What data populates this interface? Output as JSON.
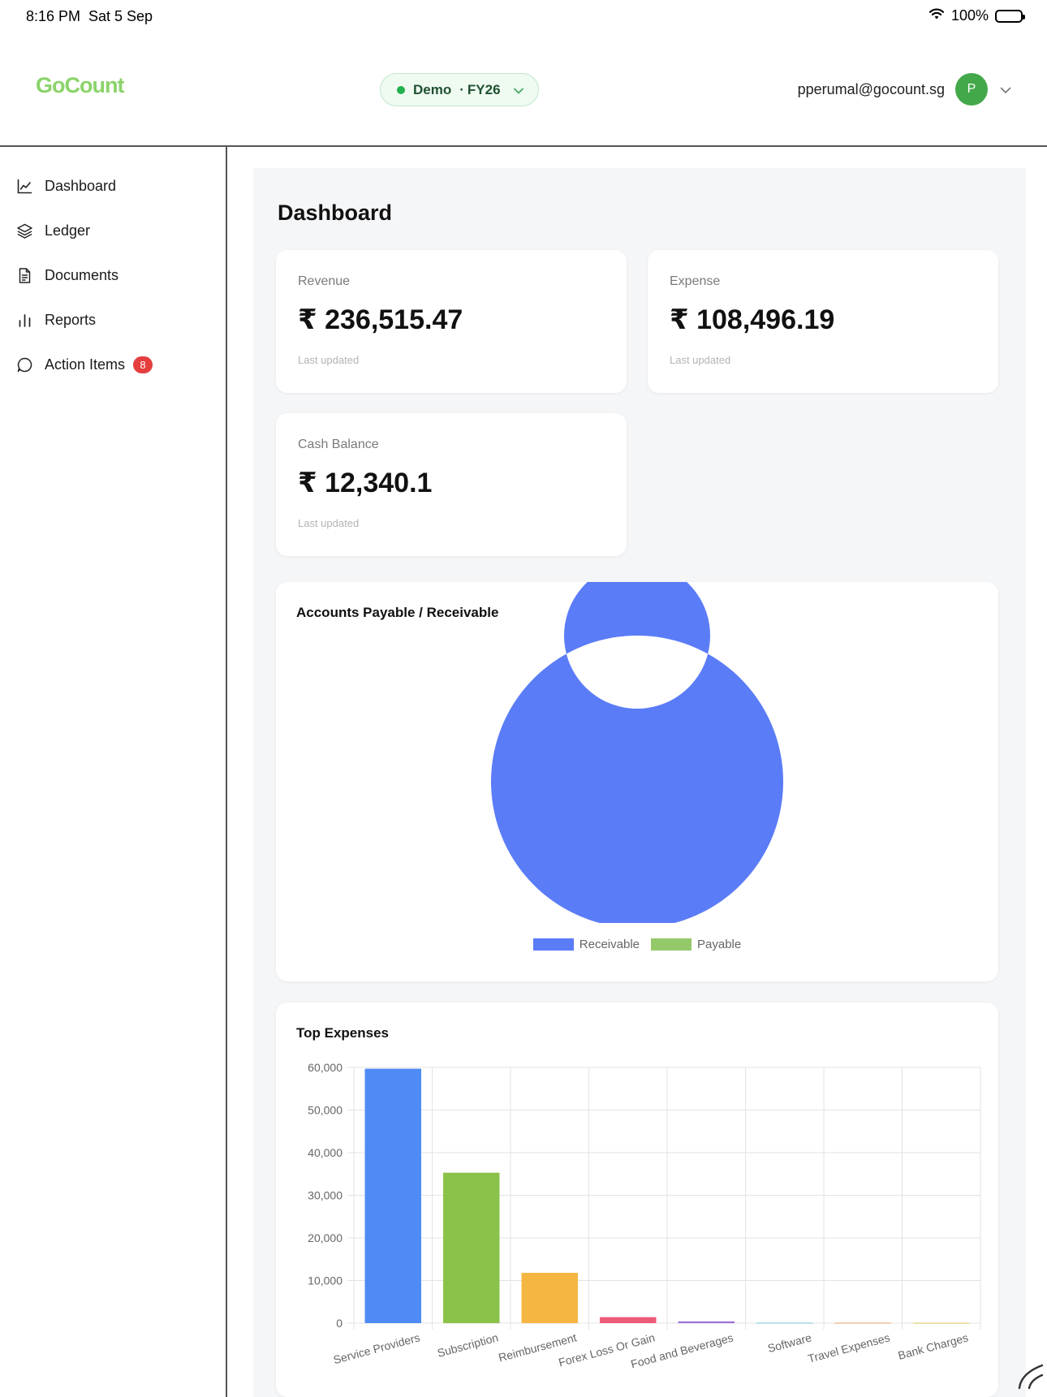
{
  "status_bar": {
    "time": "8:16 PM",
    "date": "Sat 5 Sep",
    "battery": "100%"
  },
  "header": {
    "logo": "GoCount",
    "env_name": "Demo",
    "env_separator": "·",
    "env_fy": "FY26",
    "user_email": "pperumal@gocount.sg",
    "avatar_initial": "P"
  },
  "sidebar": {
    "items": [
      {
        "label": "Dashboard",
        "icon": "line-chart-icon"
      },
      {
        "label": "Ledger",
        "icon": "layers-icon"
      },
      {
        "label": "Documents",
        "icon": "document-icon"
      },
      {
        "label": "Reports",
        "icon": "bar-chart-icon"
      },
      {
        "label": "Action Items",
        "icon": "chat-bubble-icon",
        "badge": "8"
      }
    ]
  },
  "main": {
    "title": "Dashboard",
    "stats": [
      {
        "label": "Revenue",
        "value": "₹ 236,515.47",
        "sub": "Last updated"
      },
      {
        "label": "Expense",
        "value": "₹ 108,496.19",
        "sub": "Last updated"
      },
      {
        "label": "Cash Balance",
        "value": "₹ 12,340.1",
        "sub": "Last updated"
      }
    ]
  },
  "colors": {
    "receivable": "#5b7cf7",
    "payable": "#94c96a",
    "accent_green": "#8bd36a",
    "badge_red": "#e53e3e"
  },
  "chart_data": [
    {
      "type": "pie",
      "title": "Accounts Payable / Receivable",
      "donut": true,
      "categories": [
        "Receivable",
        "Payable"
      ],
      "values": [
        100,
        0
      ],
      "colors": [
        "#5b7cf7",
        "#94c96a"
      ],
      "legend": "bottom"
    },
    {
      "type": "bar",
      "title": "Top Expenses",
      "categories": [
        "Service Providers",
        "Subscription",
        "Reimbursement",
        "Forex Loss Or Gain",
        "Food and Beverages",
        "Software",
        "Travel Expenses",
        "Bank Charges"
      ],
      "values": [
        59700,
        35300,
        11800,
        1400,
        400,
        100,
        100,
        80
      ],
      "colors": [
        "#4f8bf5",
        "#8bc34a",
        "#f5b642",
        "#ee5a7a",
        "#9b6fd6",
        "#6ec6d6",
        "#f0a060",
        "#d8c55a"
      ],
      "yticks": [
        "0",
        "10,000",
        "20,000",
        "30,000",
        "40,000",
        "50,000",
        "60,000"
      ],
      "ylim": [
        0,
        60000
      ],
      "grid": true,
      "xlabel": "",
      "ylabel": ""
    }
  ]
}
